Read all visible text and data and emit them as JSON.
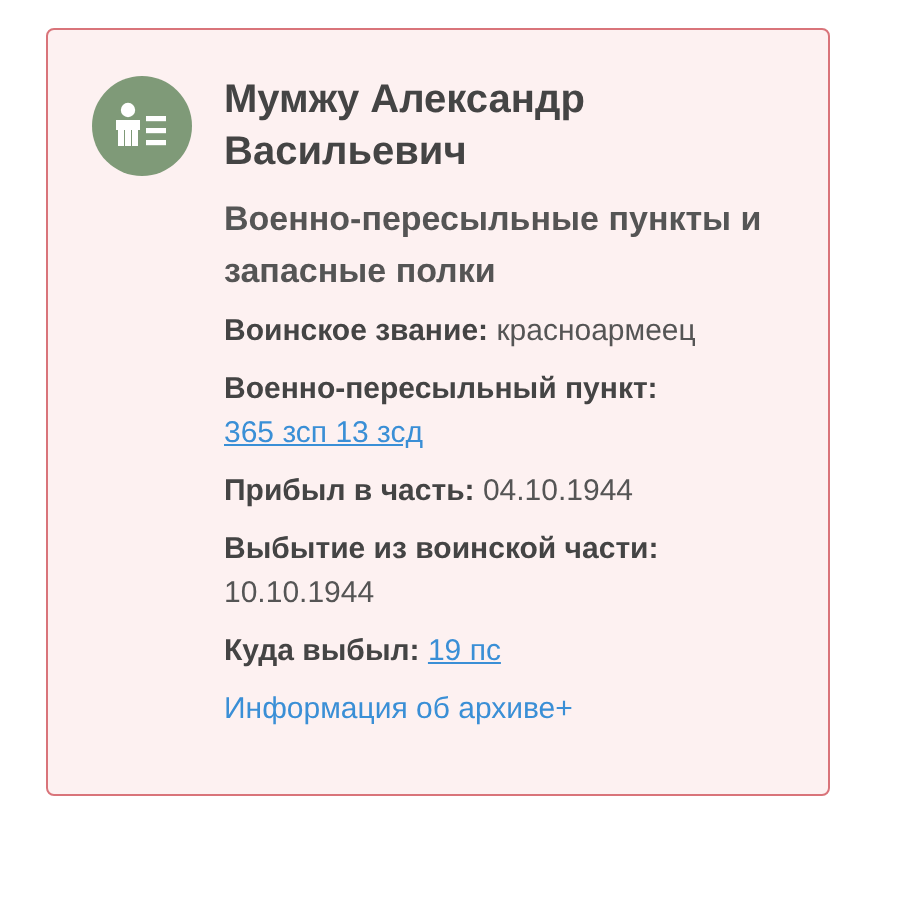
{
  "card": {
    "name": "Мумжу Александр Васильевич",
    "category": "Военно-пересыльные пункты и запасные полки",
    "fields": [
      {
        "label": "Воинское звание:",
        "value": "красноармеец",
        "kind": "text"
      },
      {
        "label": "Военно-пересыльный пункт:",
        "value": "365 зсп 13 зсд",
        "kind": "link"
      },
      {
        "label": "Прибыл в часть:",
        "value": "04.10.1944",
        "kind": "text"
      },
      {
        "label": "Выбытие из воинской части:",
        "value": "10.10.1944",
        "kind": "text"
      },
      {
        "label": "Куда выбыл:",
        "value": "19 пс",
        "kind": "link"
      }
    ],
    "archive_link": "Информация об архиве+"
  }
}
